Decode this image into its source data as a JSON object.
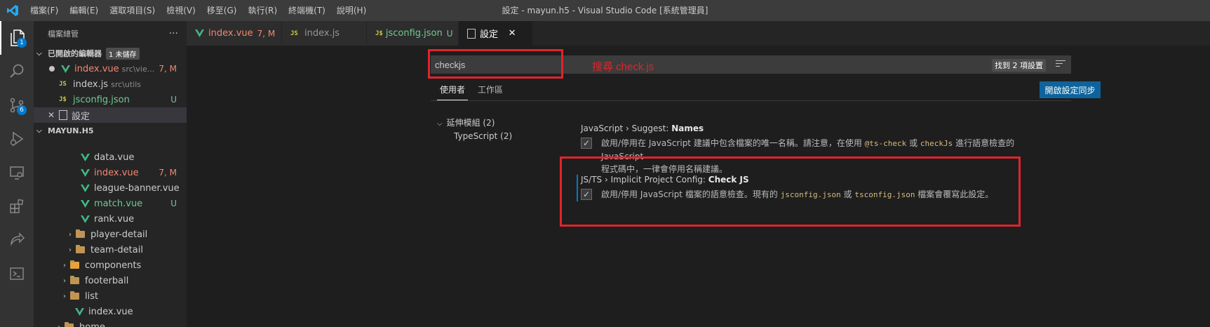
{
  "titlebar": {
    "menu": [
      "檔案(F)",
      "編輯(E)",
      "選取項目(S)",
      "檢視(V)",
      "移至(G)",
      "執行(R)",
      "終端機(T)",
      "說明(H)"
    ],
    "window_title": "設定 - mayun.h5 - Visual Studio Code [系統管理員]",
    "logo_icon": "vscode-logo-icon"
  },
  "activitybar": {
    "items": [
      {
        "icon": "explorer-icon",
        "badge": "1"
      },
      {
        "icon": "search-icon"
      },
      {
        "icon": "source-control-icon",
        "badge": "6"
      },
      {
        "icon": "run-debug-icon"
      },
      {
        "icon": "remote-explorer-icon"
      },
      {
        "icon": "extensions-icon"
      },
      {
        "icon": "live-share-icon"
      },
      {
        "icon": "terminal-icon"
      }
    ],
    "accent": "#007acc"
  },
  "sidebar": {
    "title": "檔案總管",
    "more": "···",
    "open_editors": {
      "label": "已開啟的編輯器",
      "badge": "1 未儲存",
      "items": [
        {
          "name": "index.vue",
          "desc": "src\\vie...",
          "status": "7, M"
        },
        {
          "name": "index.js",
          "desc": "src\\utils",
          "status": ""
        },
        {
          "name": "jsconfig.json",
          "desc": "",
          "status": "U"
        },
        {
          "name": "設定",
          "desc": "",
          "status": ""
        }
      ]
    },
    "project": {
      "label": "MAYUN.H5",
      "files": [
        {
          "name": "data.vue",
          "status": ""
        },
        {
          "name": "index.vue",
          "status": "7, M"
        },
        {
          "name": "league-banner.vue",
          "status": ""
        },
        {
          "name": "match.vue",
          "status": "U"
        },
        {
          "name": "rank.vue",
          "status": ""
        }
      ],
      "folders": [
        {
          "name": "player-detail"
        },
        {
          "name": "team-detail"
        },
        {
          "name": "components"
        },
        {
          "name": "footerball"
        },
        {
          "name": "list"
        }
      ],
      "trailing_file": "index.vue",
      "home_folder": "home"
    }
  },
  "tabs": [
    {
      "label": "index.vue",
      "status": "7, M",
      "icon": "vue-icon"
    },
    {
      "label": "index.js",
      "icon": "js-icon"
    },
    {
      "label": "jsconfig.json",
      "status": "U",
      "icon": "json-js-icon"
    },
    {
      "label": "設定",
      "icon": "file-icon"
    }
  ],
  "settings": {
    "search_value": "checkjs",
    "annotation": "搜尋 check.js",
    "result_count": "找到 2 項設置",
    "scopes": [
      "使用者",
      "工作區"
    ],
    "sync_button": "開啟設定同步",
    "toc": {
      "group": "延伸模組 (2)",
      "child": "TypeScript (2)"
    },
    "items": [
      {
        "category": "JavaScript › Suggest: ",
        "name": "Names",
        "checked": true,
        "desc_1": "啟用/停用在 JavaScript 建議中包含檔案的唯一名稱。請注意，在使用 ",
        "code_1": "@ts-check",
        "desc_2": " 或 ",
        "code_2": "checkJs",
        "desc_3": " 進行語意檢查的 JavaScript",
        "desc_4": "程式碼中，一律會停用名稱建議。"
      },
      {
        "category": "JS/TS › Implicit Project Config: ",
        "name": "Check JS",
        "checked": true,
        "desc_1": "啟用/停用 JavaScript 檔案的語意檢查。現有的 ",
        "code_1": "jsconfig.json",
        "desc_2": " 或 ",
        "code_2": "tsconfig.json",
        "desc_3": " 檔案會覆寫此設定。"
      }
    ],
    "checkmark": "✓"
  },
  "colors": {
    "annotation_red": "#e0242b",
    "modified": "#e2c08d",
    "error": "#f48771",
    "untracked": "#73c991",
    "vue_green": "#41b883"
  }
}
